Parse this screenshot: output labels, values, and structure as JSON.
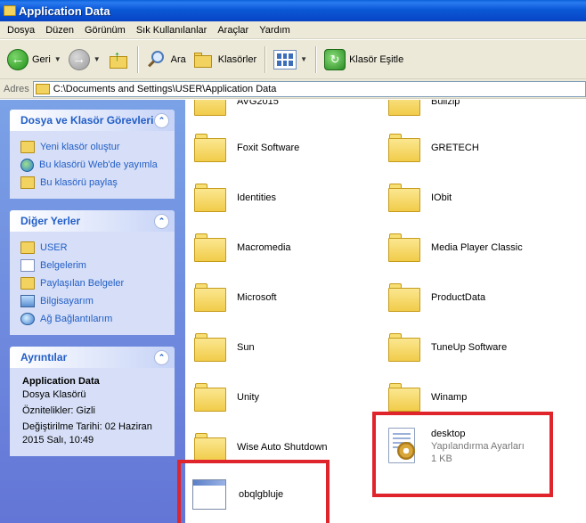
{
  "window": {
    "title": "Application Data"
  },
  "menu": [
    "Dosya",
    "Düzen",
    "Görünüm",
    "Sık Kullanılanlar",
    "Araçlar",
    "Yardım"
  ],
  "toolbar": {
    "back_label": "Geri",
    "search_label": "Ara",
    "folders_label": "Klasörler",
    "sync_label": "Klasör Eşitle"
  },
  "address": {
    "label": "Adres",
    "path": "C:\\Documents and Settings\\USER\\Application Data"
  },
  "sidebar": {
    "tasks": {
      "title": "Dosya ve Klasör Görevleri",
      "items": [
        {
          "label": "Yeni klasör oluştur",
          "icon": "new-folder-icon"
        },
        {
          "label": "Bu klasörü Web'de yayımla",
          "icon": "web-publish-icon"
        },
        {
          "label": "Bu klasörü paylaş",
          "icon": "share-folder-icon"
        }
      ]
    },
    "places": {
      "title": "Diğer Yerler",
      "items": [
        {
          "label": "USER",
          "icon": "folder-icon"
        },
        {
          "label": "Belgelerim",
          "icon": "documents-icon"
        },
        {
          "label": "Paylaşılan Belgeler",
          "icon": "shared-docs-icon"
        },
        {
          "label": "Bilgisayarım",
          "icon": "computer-icon"
        },
        {
          "label": "Ağ Bağlantılarım",
          "icon": "network-icon"
        }
      ]
    },
    "details": {
      "title": "Ayrıntılar",
      "name": "Application Data",
      "type": "Dosya Klasörü",
      "attributes": "Öznitelikler: Gizli",
      "modified": "Değiştirilme Tarihi: 02 Haziran 2015 Salı, 10:49"
    }
  },
  "files": {
    "left": [
      "AVG2015",
      "Foxit Software",
      "Identities",
      "Macromedia",
      "Microsoft",
      "Sun",
      "Unity",
      "Wise Auto Shutdown"
    ],
    "right": [
      "Bullzip",
      "GRETECH",
      "IObit",
      "Media Player Classic",
      "ProductData",
      "TuneUp Software",
      "Winamp"
    ],
    "desktop": {
      "name": "desktop",
      "type": "Yapılandırma Ayarları",
      "size": "1 KB"
    },
    "exe": {
      "name": "obqlgbluje"
    }
  },
  "colors": {
    "highlight": "#e0242c",
    "link": "#215dc6",
    "sidebar": "#6375d6"
  }
}
